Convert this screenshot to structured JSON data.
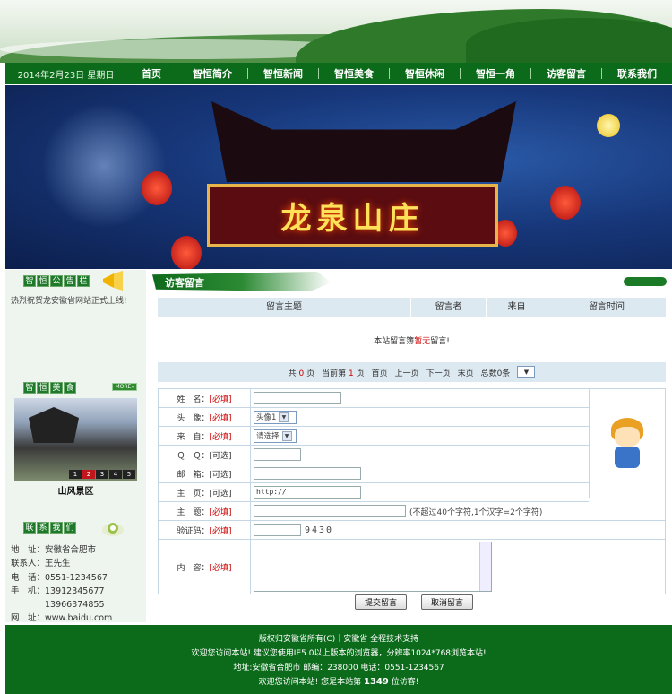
{
  "nav": {
    "date": "2014年2月23日 星期日",
    "items": [
      "首页",
      "智恒简介",
      "智恒新闻",
      "智恒美食",
      "智恒休闲",
      "智恒一角",
      "访客留言",
      "联系我们"
    ]
  },
  "hero": {
    "sign_text": "龙泉山庄"
  },
  "sidebar": {
    "notice_title": [
      "智",
      "恒",
      "公",
      "告",
      "栏"
    ],
    "notice_text": "热烈祝贺龙安徽省网站正式上线!",
    "food_title": [
      "智",
      "恒",
      "美",
      "食"
    ],
    "more": "MORE»",
    "photo_pager": [
      "1",
      "2",
      "3",
      "4",
      "5"
    ],
    "photo_caption": "山风景区",
    "contact_title": [
      "联",
      "系",
      "我",
      "们"
    ],
    "contact": [
      "地　址：安徽省合肥市",
      "联系人：王先生",
      "电　话：0551-1234567",
      "手　机：13912345677",
      "　　　　13966374855",
      "网　址：www.baidu.com"
    ]
  },
  "main": {
    "section_title": "访客留言",
    "grid_headers": [
      "留言主题",
      "留言者",
      "来自",
      "留言时间"
    ],
    "empty_prefix": "本站留言簿",
    "empty_red": "暂无",
    "empty_suffix": "留言!",
    "pagebar": {
      "total_pre": "共",
      "total": "0",
      "total_post": "页",
      "cur_pre": "当前第",
      "cur": "1",
      "cur_post": "页",
      "first": "首页",
      "prev": "上一页",
      "next": "下一页",
      "last": "末页",
      "count": "总数0条"
    },
    "form": {
      "required": "[必填]",
      "optional": "[可选]",
      "name_label": "姓　名：",
      "avatar_label": "头　像：",
      "avatar_value": "头像1",
      "from_label": "来　自：",
      "from_value": "请选择",
      "qq_label": "Ｑ　Ｑ：",
      "email_label": "邮　箱：",
      "home_label": "主　页：",
      "home_value": "http://",
      "subject_label": "主　题：",
      "subject_hint": "(不超过40个字符,1个汉字=2个字符)",
      "captcha_label": "验证码：",
      "captcha_value": "9430",
      "content_label": "内　容："
    },
    "submit": "提交留言",
    "cancel": "取消留言"
  },
  "footer": {
    "line1": "版权归安徽省所有(C)｜安徽省 全程技术支持",
    "line2": "欢迎您访问本站! 建议您使用IE5.0以上版本的浏览器，分辨率1024*768浏览本站!",
    "line3": "地址:安徽省合肥市 邮编：238000 电话：0551-1234567",
    "line4_pre": "欢迎您访问本站! 您是本站第",
    "visits": "1349",
    "line4_post": "位访客!"
  }
}
